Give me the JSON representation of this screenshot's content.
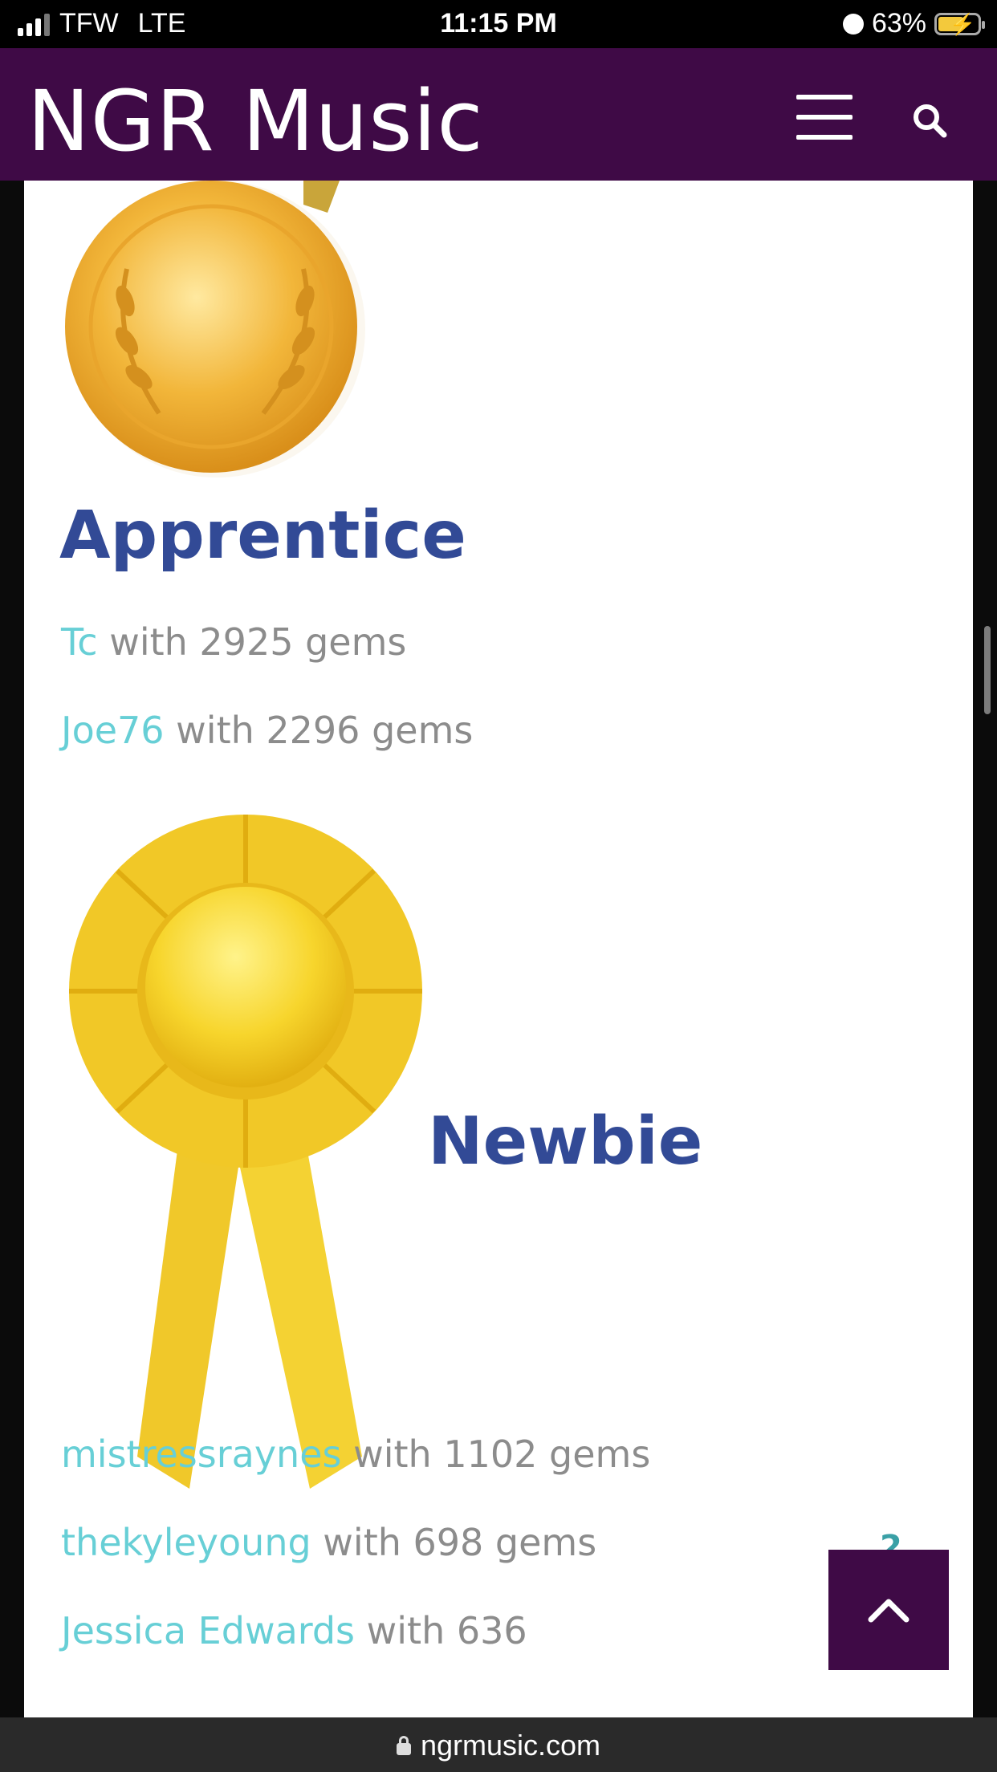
{
  "status_bar": {
    "carrier": "TFW",
    "network": "LTE",
    "time": "11:15 PM",
    "battery": "63%"
  },
  "header": {
    "title": "NGR Music"
  },
  "ranks": [
    {
      "name": "Apprentice",
      "badge": "gold-medal",
      "entries": [
        {
          "user": "Tc",
          "text": " with 2925 gems"
        },
        {
          "user": "Joe76",
          "text": " with 2296 gems"
        }
      ]
    },
    {
      "name": "Newbie",
      "badge": "yellow-rosette",
      "entries": [
        {
          "user": "mistressraynes",
          "text": " with 1102 gems"
        },
        {
          "user": "thekyleyoung",
          "text": " with 698 gems"
        },
        {
          "user": "Jessica Edwards",
          "text": " with 636"
        }
      ]
    }
  ],
  "floating_number": "2",
  "url_bar": {
    "url": "ngrmusic.com"
  },
  "colors": {
    "header_bg": "#3f0a46",
    "heading": "#324a96",
    "username": "#67cfd6",
    "entry_text": "#8c8c8c"
  }
}
